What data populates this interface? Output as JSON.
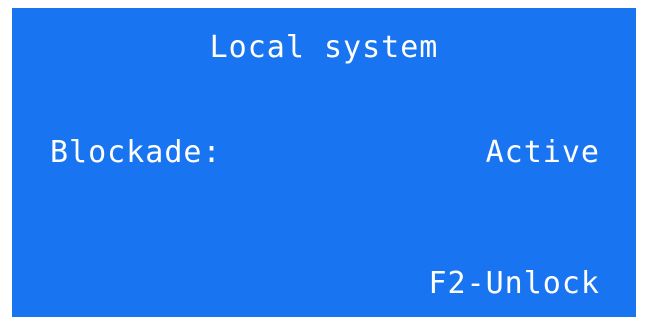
{
  "screen": {
    "title": "Local system",
    "status_label": "Blockade:",
    "status_value": "Active",
    "softkey_label": "F2-Unlock",
    "background_color": "#1874f0",
    "text_color": "#ffffff"
  }
}
